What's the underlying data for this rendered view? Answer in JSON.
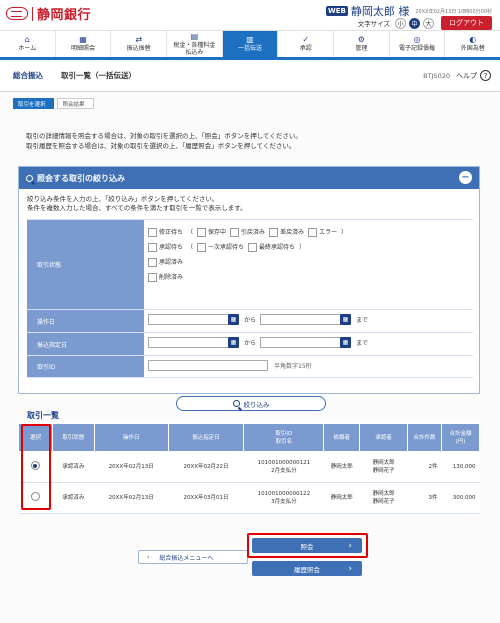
{
  "header": {
    "bank_name": "静岡銀行",
    "user_badge": "WEB",
    "user_name": "静岡太郎 様",
    "login_time": "20XX年02月13日 10時00分00秒",
    "font_size_label": "文字サイズ",
    "font_sizes": [
      "小",
      "中",
      "大"
    ],
    "logout_label": "ログアウト"
  },
  "nav": [
    {
      "label": "ホーム",
      "icon": "home-icon",
      "glyph": "⌂"
    },
    {
      "label": "明細照会",
      "icon": "statement-icon",
      "glyph": "▦"
    },
    {
      "label": "振込振替",
      "icon": "transfer-icon",
      "glyph": "⇄"
    },
    {
      "label": "税金・各種料金\n払込み",
      "icon": "tax-icon",
      "glyph": "▤"
    },
    {
      "label": "一括伝送",
      "icon": "bulk-icon",
      "glyph": "▥"
    },
    {
      "label": "承認",
      "icon": "approve-icon",
      "glyph": "✓"
    },
    {
      "label": "管理",
      "icon": "manage-icon",
      "glyph": "⚙"
    },
    {
      "label": "電子記録債権",
      "icon": "erecord-icon",
      "glyph": "◎"
    },
    {
      "label": "外国為替",
      "icon": "forex-icon",
      "glyph": "◐"
    }
  ],
  "page": {
    "service": "総合振込",
    "title": "取引一覧（一括伝送）",
    "screen_id": "BTJS020",
    "help_label": "ヘルプ",
    "steps": [
      "取引を選択",
      "照会結果"
    ],
    "instructions": [
      "取引の詳細情報を照会する場合は、対象の取引を選択の上、「照会」ボタンを押してください。",
      "取引履歴を照会する場合は、対象の取引を選択の上、「履歴照会」ボタンを押してください。"
    ]
  },
  "filter": {
    "title": "照会する取引の絞り込み",
    "desc": [
      "絞り込み条件を入力の上、「絞り込み」ボタンを押してください。",
      "条件を複数入力した場合、すべての条件を満たす取引を一覧で表示します。"
    ],
    "status_label": "取引状態",
    "status_line1": [
      "修正待ち",
      "（",
      "保存中",
      "引戻済み",
      "差戻済み",
      "エラー",
      "）"
    ],
    "status_line2": [
      "承認待ち",
      "（",
      "一次承認待ち",
      "最終承認待ち",
      "）"
    ],
    "status_line3": "承認済み",
    "status_line4": "削除済み",
    "op_date_label": "操作日",
    "transfer_date_label": "振込指定日",
    "from": "から",
    "to": "まで",
    "id_label": "取引ID",
    "id_hint": "半角数字15桁",
    "narrow_button": "絞り込み"
  },
  "list": {
    "title": "取引一覧",
    "headers": [
      "選択",
      "取引状態",
      "操作日",
      "振込指定日",
      "取引ID\n取引名",
      "依頼者",
      "承認者",
      "合計件数",
      "合計金額\n(円)"
    ],
    "rows": [
      {
        "selected": true,
        "status": "承認済み",
        "op_date": "20XX年02月13日",
        "transfer_date": "20XX年02月22日",
        "id": "101001000000121",
        "name": "2月支払分",
        "requester": "静岡太郎",
        "approver1": "静岡太郎",
        "approver2": "静岡花子",
        "count": "2件",
        "amount": "130,000"
      },
      {
        "selected": false,
        "status": "承認済み",
        "op_date": "20XX年02月13日",
        "transfer_date": "20XX年03月01日",
        "id": "101001000000122",
        "name": "3月支払分",
        "requester": "静岡太郎",
        "approver1": "静岡太郎",
        "approver2": "静岡花子",
        "count": "3件",
        "amount": "300,000"
      }
    ]
  },
  "buttons": {
    "back": "総合振込メニューへ",
    "inquiry": "照会",
    "history": "履歴照会"
  },
  "colors": {
    "brand_red": "#cc1f2d",
    "navy": "#1d3f86",
    "nav_active": "#1d6fc1",
    "header_blue": "#3f6fb5",
    "label_blue": "#7b9bd0",
    "highlight_red": "#e00000"
  }
}
